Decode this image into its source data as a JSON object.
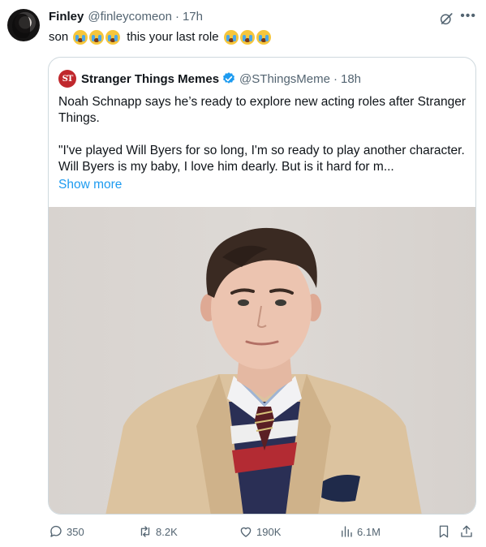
{
  "tweet": {
    "author_name": "Finley",
    "author_handle": "@finleycomeon",
    "separator": "·",
    "time": "17h",
    "text_prefix": "son",
    "text_middle": "this your last role",
    "emoji_name": "loudly-crying-face"
  },
  "quoted": {
    "avatar_text": "ST",
    "author_name": "Stranger Things Memes",
    "author_handle": "@SThingsMeme",
    "separator": "·",
    "time": "18h",
    "paragraph1": "Noah Schnapp says he’s ready to explore new acting roles after Stranger Things.",
    "paragraph2": "\"I've played Will Byers for so long, I'm so ready to play another character. Will Byers is my baby, I love him dearly. But is it hard for m...",
    "show_more": "Show more",
    "image_alt": "portrait-photo"
  },
  "actions": {
    "replies": "350",
    "reposts": "8.2K",
    "likes": "190K",
    "views": "6.1M"
  },
  "colors": {
    "text": "#0f1419",
    "muted": "#536471",
    "link": "#1d9bf0",
    "verified": "#1d9bf0",
    "border": "#cfd9de",
    "brand_red": "#c0282d"
  }
}
